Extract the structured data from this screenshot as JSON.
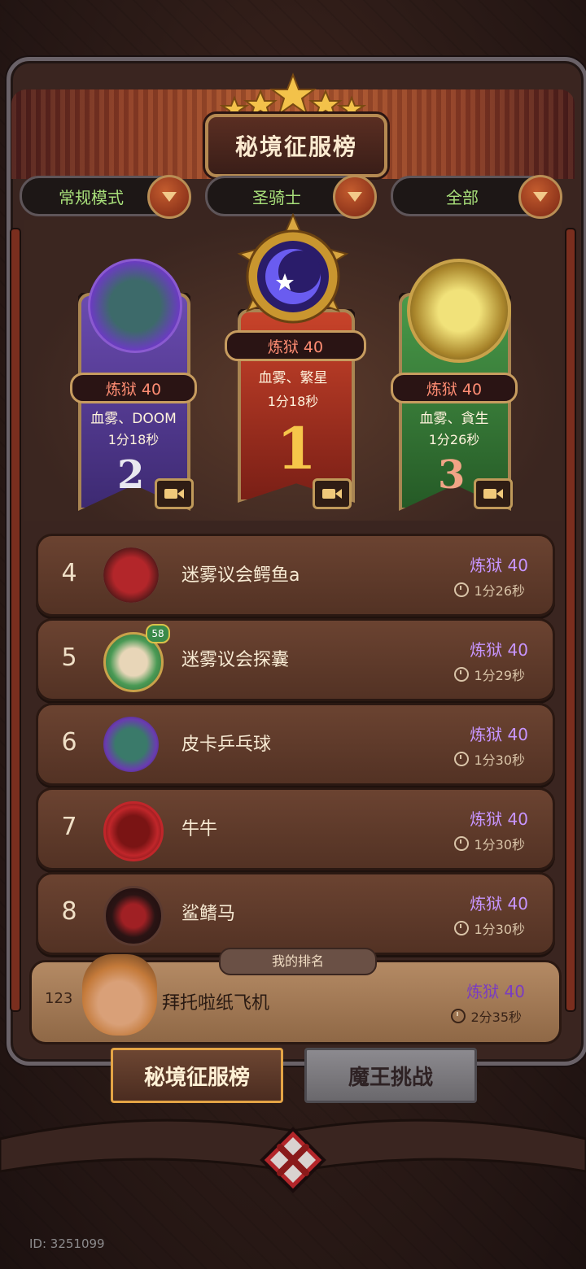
{
  "title": "秘境征服榜",
  "filters": [
    {
      "label": "常规模式"
    },
    {
      "label": "圣骑士"
    },
    {
      "label": "全部"
    }
  ],
  "podium": {
    "first": {
      "rank": "1",
      "level": "炼狱 40",
      "tags": "血雾、繁星",
      "time": "1分18秒"
    },
    "second": {
      "rank": "2",
      "level": "炼狱 40",
      "tags": "血雾、DOOM",
      "time": "1分18秒"
    },
    "third": {
      "rank": "3",
      "level": "炼狱 40",
      "tags": "血雾、貪生",
      "time": "1分26秒"
    }
  },
  "list": [
    {
      "rank": "4",
      "name": "迷雾议会鳄鱼a",
      "level": "炼狱 40",
      "time": "1分26秒",
      "avatar_color": "#b3262a"
    },
    {
      "rank": "5",
      "name": "迷雾议会探囊",
      "level": "炼狱 40",
      "time": "1分29秒",
      "avatar_color": "#4a9a55",
      "badge": "58"
    },
    {
      "rank": "6",
      "name": "皮卡乒乓球",
      "level": "炼狱 40",
      "time": "1分30秒",
      "avatar_color": "#6a3cb0"
    },
    {
      "rank": "7",
      "name": "牛牛",
      "level": "炼狱 40",
      "time": "1分30秒",
      "avatar_color": "#c0262a"
    },
    {
      "rank": "8",
      "name": "鲨鳍马",
      "level": "炼狱 40",
      "time": "1分30秒",
      "avatar_color": "#2a1414"
    }
  ],
  "my_rank": {
    "tag": "我的排名",
    "rank": "123",
    "name": "拜托啦纸飞机",
    "level": "炼狱 40",
    "time": "2分35秒"
  },
  "tabs": {
    "active": "秘境征服榜",
    "inactive": "魔王挑战"
  },
  "user_id": "ID: 3251099",
  "colors": {
    "level_purple": "#c795ff",
    "level_red": "#ff8d73",
    "filter_green": "#a8df7a",
    "gold": "#e4a445"
  }
}
